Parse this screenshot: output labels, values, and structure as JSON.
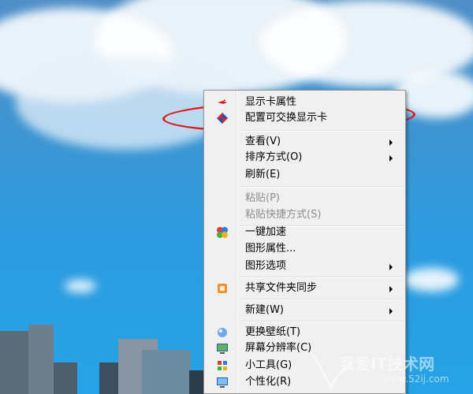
{
  "context_menu": {
    "items": [
      {
        "label": "显示卡属性",
        "icon": "graphics-card-icon"
      },
      {
        "label": "配置可交换显示卡",
        "icon": "switchable-graphics-icon"
      },
      {
        "label": "查看(V)",
        "submenu": true
      },
      {
        "label": "排序方式(O)",
        "submenu": true
      },
      {
        "label": "刷新(E)"
      },
      {
        "label": "粘贴(P)",
        "disabled": true
      },
      {
        "label": "粘贴快捷方式(S)",
        "disabled": true
      },
      {
        "label": "一键加速",
        "icon": "speed-boost-icon"
      },
      {
        "label": "图形属性..."
      },
      {
        "label": "图形选项",
        "submenu": true
      },
      {
        "label": "共享文件夹同步",
        "icon": "folder-sync-icon",
        "submenu": true
      },
      {
        "label": "新建(W)",
        "submenu": true
      },
      {
        "label": "更换壁纸(T)",
        "icon": "wallpaper-icon"
      },
      {
        "label": "屏幕分辨率(C)",
        "icon": "screen-resolution-icon"
      },
      {
        "label": "小工具(G)",
        "icon": "gadgets-icon"
      },
      {
        "label": "个性化(R)",
        "icon": "personalize-icon"
      }
    ]
  },
  "annotation": {
    "color": "#e01818"
  },
  "watermark": {
    "text": "我爱IT技术网",
    "url": "www.52ij.com"
  }
}
